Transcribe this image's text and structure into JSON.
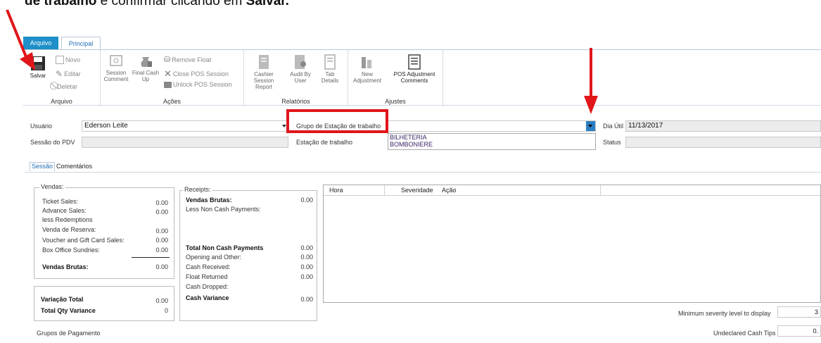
{
  "caption": {
    "prefix": "de trabalho",
    "middle": " e confirmar clicando em ",
    "suffix": "Salvar."
  },
  "ribbon": {
    "tab_file": "Arquivo",
    "tab_main": "Principal",
    "groups": {
      "arquivo": "Arquivo",
      "acoes": "Ações",
      "relatorios": "Relatórios",
      "ajustes": "Ajustes"
    },
    "save": "Salvar",
    "new": "Novo",
    "edit": "Editar",
    "delete": "Deletar",
    "session_comment_1": "Session",
    "session_comment_2": "Comment",
    "final_cash_up_1": "Final Cash",
    "final_cash_up_2": "Up",
    "remove_float": "Remove Float",
    "close_pos_session": "Close POS Session",
    "unlock_pos_session": "Unlock POS Session",
    "cashier_report_1": "Cashier Session",
    "cashier_report_2": "Report",
    "audit_by_user_1": "Audit By",
    "audit_by_user_2": "User",
    "tab_details_1": "Tab",
    "tab_details_2": "Details",
    "new_adjustment_1": "New",
    "new_adjustment_2": "Adjustment",
    "pos_adjustment_1": "POS Adjustment",
    "pos_adjustment_2": "Comments"
  },
  "form": {
    "user_label": "Usuário",
    "user_value": "Ederson Leite",
    "group_label": "Grupo de Estação de trabalho",
    "group_value": "",
    "business_day_label": "Dia Útil",
    "business_day_value": "11/13/2017",
    "pos_session_label": "Sessão do PDV",
    "workstation_label": "Estação de trabalho",
    "status_label": "Status",
    "dropdown_options": [
      "BILHETERIA",
      "BOMBONIERE"
    ]
  },
  "tabs": {
    "session": "Sessão",
    "comments": "Comentários"
  },
  "sales": {
    "title": "Vendas:",
    "rows": [
      {
        "label": "Ticket Sales:",
        "value": "0.00"
      },
      {
        "label": "Advance Sales:",
        "value": "0.00"
      },
      {
        "label": "less Redemptions",
        "value": ""
      },
      {
        "label": "Venda de Reserva:",
        "value": "0.00"
      },
      {
        "label": "Voucher and Gift Card Sales:",
        "value": "0.00"
      },
      {
        "label": "Box Office Sundries:",
        "value": "0.00"
      }
    ],
    "gross_label": "Vendas Brutas:",
    "gross_value": "0.00"
  },
  "variance": {
    "total_label": "Variação Total",
    "total_value": "0.00",
    "qty_label": "Total Qty Variance",
    "qty_value": "0"
  },
  "receipts": {
    "title": "Receipts:",
    "gross_label": "Vendas Brutas:",
    "gross_value": "0.00",
    "less_non_cash": "Less Non Cash Payments:",
    "total_non_cash_label": "Total Non Cash Payments",
    "total_non_cash_value": "0.00",
    "rows": [
      {
        "label": "Opening and Other:",
        "value": "0.00"
      },
      {
        "label": "Cash Received:",
        "value": "0.00"
      },
      {
        "label": "Float Returned",
        "value": "0.00"
      },
      {
        "label": "Cash Dropped:",
        "value": ""
      }
    ],
    "variance_label": "Cash Variance",
    "variance_value": "0.00"
  },
  "log": {
    "col_time": "Hora",
    "col_severity": "Severidade",
    "col_action": "Ação"
  },
  "footer": {
    "payment_groups": "Grupos de Pagamento",
    "min_severity_label": "Minimum severity level to display",
    "min_severity_value": "3",
    "undeclared_tips_label": "Undeclared Cash Tips",
    "undeclared_tips_value": "0."
  },
  "colors": {
    "accent": "#1e8fc9",
    "annotation": "#e0161b"
  }
}
